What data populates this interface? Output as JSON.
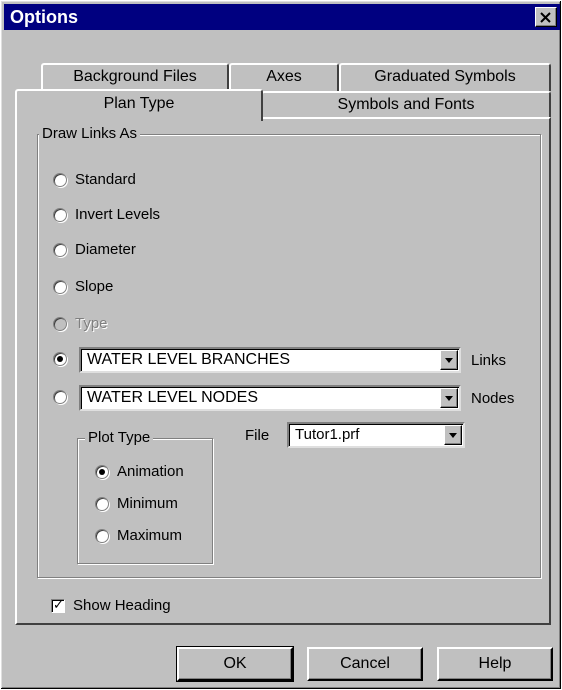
{
  "window": {
    "title": "Options"
  },
  "tabs": {
    "back_row": [
      "Background Files",
      "Axes",
      "Graduated Symbols"
    ],
    "front_row": [
      "Plan Type",
      "Symbols and Fonts"
    ],
    "active": "Plan Type"
  },
  "draw_links": {
    "group_label": "Draw Links As",
    "options": [
      {
        "label": "Standard",
        "checked": false,
        "disabled": false
      },
      {
        "label": "Invert Levels",
        "checked": false,
        "disabled": false
      },
      {
        "label": "Diameter",
        "checked": false,
        "disabled": false
      },
      {
        "label": "Slope",
        "checked": false,
        "disabled": false
      },
      {
        "label": "Type",
        "checked": false,
        "disabled": true
      }
    ],
    "links_combo": {
      "value": "WATER LEVEL BRANCHES",
      "label": "Links",
      "checked": true
    },
    "nodes_combo": {
      "value": "WATER LEVEL NODES",
      "label": "Nodes",
      "checked": false
    }
  },
  "plot_type": {
    "group_label": "Plot Type",
    "options": [
      {
        "label": "Animation",
        "checked": true
      },
      {
        "label": "Minimum",
        "checked": false
      },
      {
        "label": "Maximum",
        "checked": false
      }
    ]
  },
  "file": {
    "label": "File",
    "value": "Tutor1.prf"
  },
  "show_heading": {
    "label": "Show Heading",
    "checked": true
  },
  "buttons": {
    "ok": "OK",
    "cancel": "Cancel",
    "help": "Help"
  }
}
